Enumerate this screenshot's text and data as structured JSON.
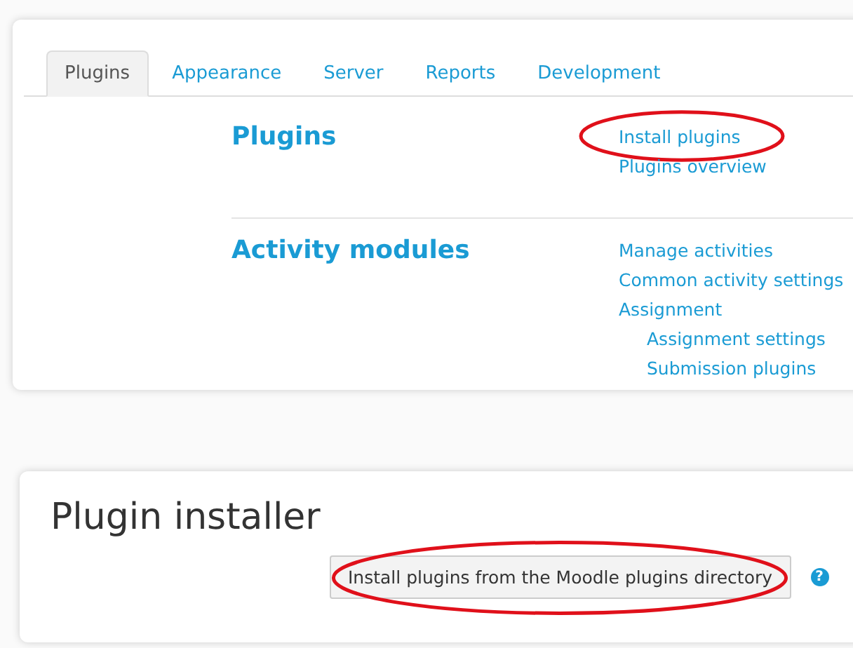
{
  "tabs": [
    {
      "label": "Plugins",
      "selected": true
    },
    {
      "label": "Appearance",
      "selected": false
    },
    {
      "label": "Server",
      "selected": false
    },
    {
      "label": "Reports",
      "selected": false
    },
    {
      "label": "Development",
      "selected": false
    }
  ],
  "sections": [
    {
      "heading": "Plugins",
      "links": [
        {
          "label": "Install plugins",
          "highlighted": true
        },
        {
          "label": "Plugins overview",
          "highlighted": false
        }
      ]
    },
    {
      "heading": "Activity modules",
      "links": [
        {
          "label": "Manage activities",
          "highlighted": false
        },
        {
          "label": "Common activity settings",
          "highlighted": false
        },
        {
          "label": "Assignment",
          "highlighted": false,
          "children": [
            {
              "label": "Assignment settings",
              "highlighted": false
            },
            {
              "label": "Submission plugins",
              "highlighted": false
            }
          ]
        }
      ]
    }
  ],
  "installer": {
    "title": "Plugin installer",
    "button": {
      "label": "Install plugins from the Moodle plugins directory",
      "highlighted": true
    },
    "help": "?"
  }
}
